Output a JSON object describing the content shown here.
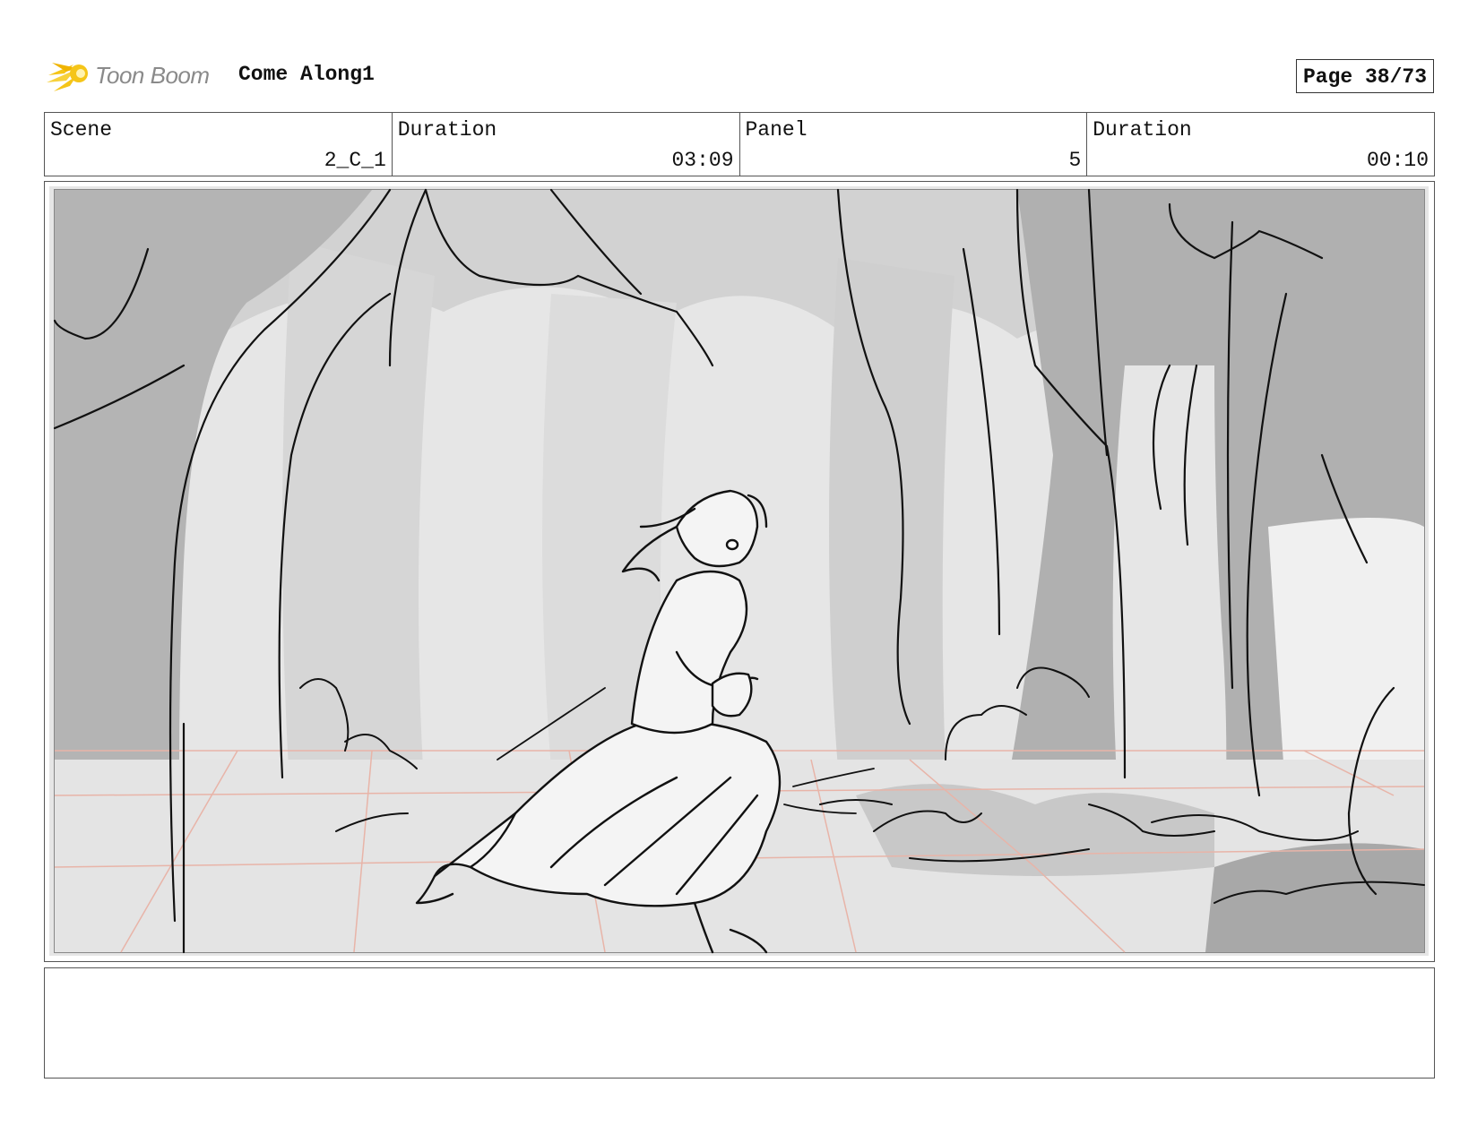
{
  "header": {
    "logo_text": "Toon Boom",
    "project_title": "Come Along1",
    "page_label": "Page 38/73"
  },
  "info": {
    "scene_label": "Scene",
    "scene_value": "2_C_1",
    "scene_duration_label": "Duration",
    "scene_duration_value": "03:09",
    "panel_label": "Panel",
    "panel_value": "5",
    "panel_duration_label": "Duration",
    "panel_duration_value": "00:10"
  },
  "notes": {
    "text": ""
  },
  "colors": {
    "logo_flame": "#f5c518",
    "perspective_grid": "#e8b4a8",
    "frame_border": "#555555"
  }
}
